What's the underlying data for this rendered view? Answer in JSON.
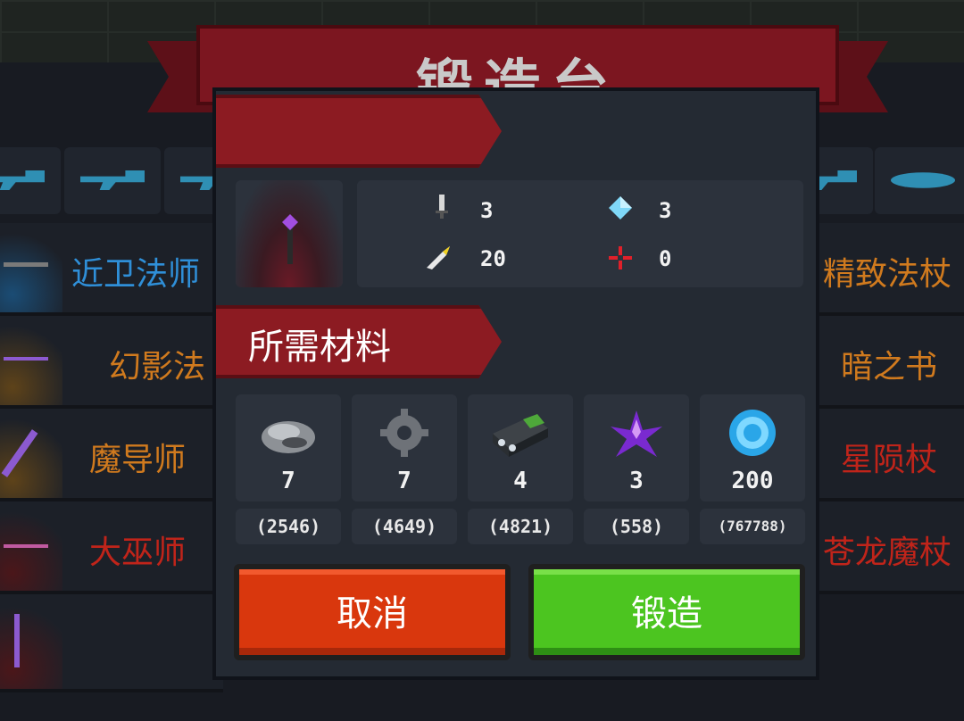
{
  "title": "锻造台",
  "colors": {
    "accent_red": "#8c1b22",
    "cancel": "#d9370d",
    "forge": "#4cc520"
  },
  "left_list": [
    {
      "label": "近卫法师",
      "color": "#2f8fd8"
    },
    {
      "label": "幻影法",
      "color": "#d07a1e"
    },
    {
      "label": "魔导师",
      "color": "#d07a1e"
    },
    {
      "label": "大巫师",
      "color": "#c0241a"
    },
    {
      "label": "",
      "color": "#8c5ad0"
    }
  ],
  "right_list": [
    {
      "label": "精致法杖",
      "color": "#d07a1e"
    },
    {
      "label": "暗之书",
      "color": "#d07a1e"
    },
    {
      "label": "星陨杖",
      "color": "#c0241a"
    },
    {
      "label": "苍龙魔杖",
      "color": "#c0241a"
    }
  ],
  "modal": {
    "item_icon": "purple-staff-icon",
    "stats": {
      "damage": "3",
      "mana_cost": "3",
      "crit": "20",
      "spread": "0"
    },
    "materials_title": "所需材料",
    "materials": [
      {
        "icon": "ore-icon",
        "count": "7",
        "stock": "(2546)"
      },
      {
        "icon": "gear-part-icon",
        "count": "7",
        "stock": "(4649)"
      },
      {
        "icon": "battery-icon",
        "count": "4",
        "stock": "(4821)"
      },
      {
        "icon": "purple-crystal-icon",
        "count": "3",
        "stock": "(558)"
      },
      {
        "icon": "blue-gem-icon",
        "count": "200",
        "stock": "(767788)"
      }
    ],
    "cancel_label": "取消",
    "forge_label": "锻造"
  }
}
